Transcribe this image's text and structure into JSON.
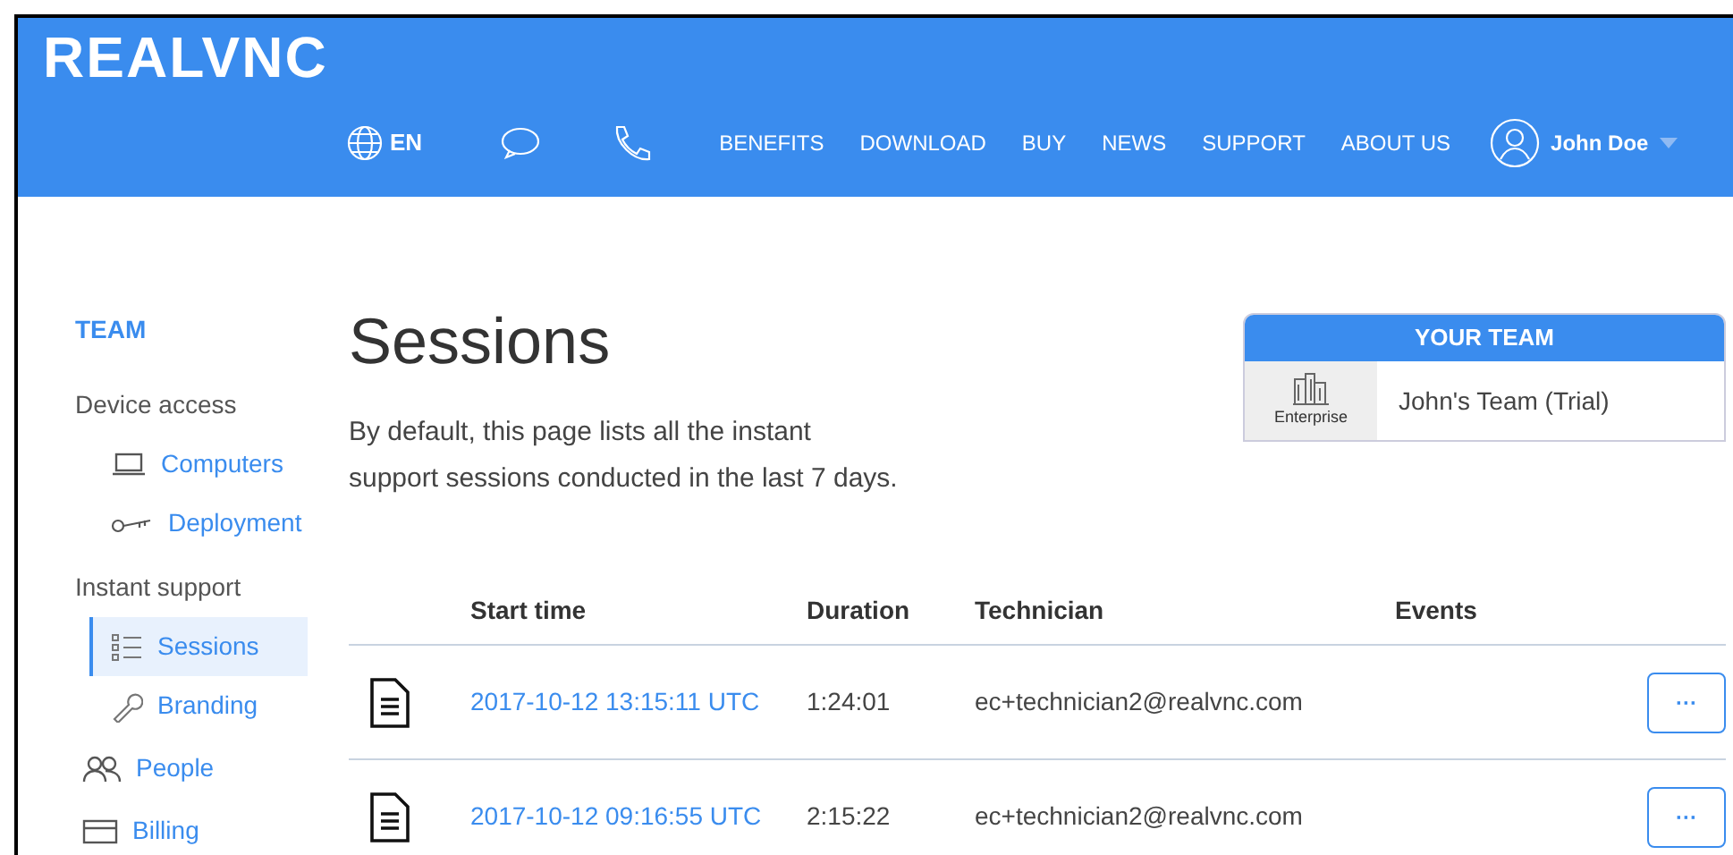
{
  "header": {
    "logo": "REALVNC",
    "language": "EN",
    "nav": [
      "BENEFITS",
      "DOWNLOAD",
      "BUY",
      "NEWS",
      "SUPPORT",
      "ABOUT US"
    ],
    "user": "John Doe"
  },
  "sidebar": {
    "title": "TEAM",
    "sections": [
      {
        "kind": "heading",
        "label": "Device access"
      },
      {
        "kind": "sub",
        "label": "Computers",
        "selected": false
      },
      {
        "kind": "sub",
        "label": "Deployment",
        "selected": false
      },
      {
        "kind": "heading",
        "label": "Instant support"
      },
      {
        "kind": "sub",
        "label": "Sessions",
        "selected": true
      },
      {
        "kind": "sub",
        "label": "Branding",
        "selected": false
      },
      {
        "kind": "top",
        "label": "People",
        "selected": false
      },
      {
        "kind": "top",
        "label": "Billing",
        "selected": false
      }
    ]
  },
  "page": {
    "title": "Sessions",
    "description": "By default, this page lists all the instant support sessions conducted in the last 7 days."
  },
  "team_card": {
    "title": "YOUR TEAM",
    "plan": "Enterprise",
    "name": "John's Team (Trial)"
  },
  "table": {
    "columns": [
      "Start time",
      "Duration",
      "Technician",
      "Events"
    ],
    "rows": [
      {
        "start": "2017-10-12 13:15:11 UTC",
        "duration": "1:24:01",
        "technician": "ec+technician2@realvnc.com",
        "action": "···"
      },
      {
        "start": "2017-10-12 09:16:55 UTC",
        "duration": "2:15:22",
        "technician": "ec+technician2@realvnc.com",
        "action": "···"
      }
    ]
  }
}
